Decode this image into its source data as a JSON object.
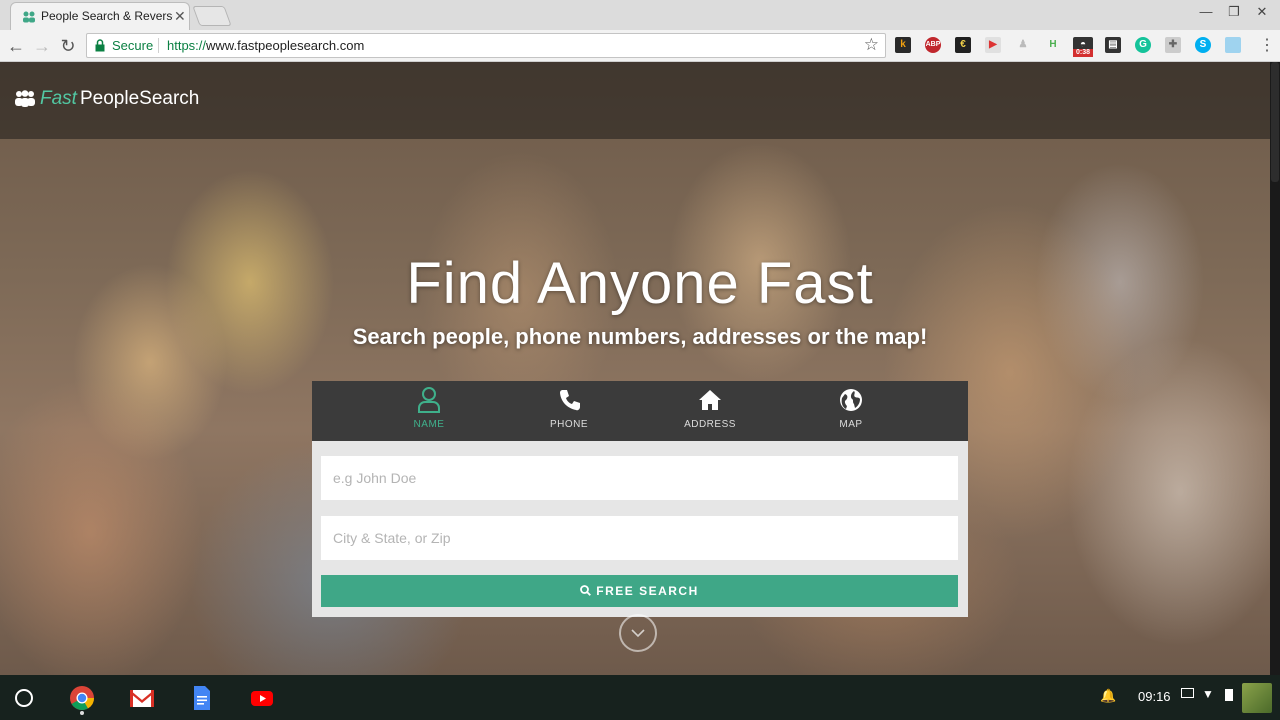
{
  "browser": {
    "tab_title": "People Search & Reverse",
    "secure_label": "Secure",
    "url_scheme": "https://",
    "url_host": "www.fastpeoplesearch.com",
    "extension_badge_timer": "0:38",
    "extension_icons": [
      "k-extension-icon",
      "adblock-plus-icon",
      "evernote-icon",
      "pocket-icon",
      "ghost-icon",
      "h-extension-icon",
      "timer-extension-icon",
      "film-icon",
      "grammarly-icon",
      "puzzle-icon",
      "skype-icon",
      "image-extension-icon"
    ]
  },
  "site": {
    "logo_fast": "Fast",
    "logo_rest": "PeopleSearch",
    "hero_title": "Find Anyone Fast",
    "hero_subtitle": "Search people, phone numbers, addresses or the map!",
    "accent_color": "#3fa787",
    "tabs": [
      {
        "label": "NAME",
        "icon": "person-icon",
        "active": true
      },
      {
        "label": "PHONE",
        "icon": "phone-icon",
        "active": false
      },
      {
        "label": "ADDRESS",
        "icon": "house-icon",
        "active": false
      },
      {
        "label": "MAP",
        "icon": "globe-icon",
        "active": false
      }
    ],
    "name_placeholder": "e.g John Doe",
    "location_placeholder": "City & State, or Zip",
    "search_button": "FREE SEARCH"
  },
  "shelf": {
    "apps": [
      "chrome-icon",
      "gmail-icon",
      "docs-icon",
      "youtube-icon"
    ],
    "time": "09:16"
  }
}
